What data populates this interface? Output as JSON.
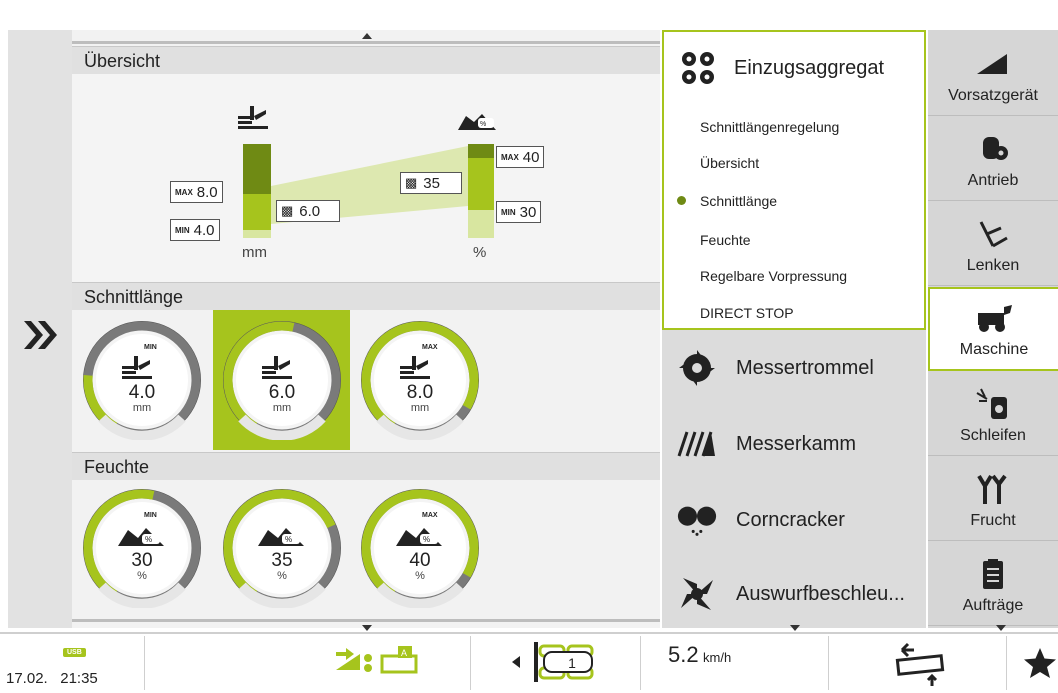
{
  "overview": {
    "title": "Übersicht",
    "left_bar": {
      "max": "8.0",
      "min": "4.0",
      "current": "6.0",
      "unit": "mm",
      "max_tag": "MAX",
      "min_tag": "MIN"
    },
    "right_bar": {
      "max": "40",
      "min": "30",
      "current": "35",
      "unit": "%",
      "max_tag": "MAX",
      "min_tag": "MIN"
    }
  },
  "schnittlaenge": {
    "title": "Schnittlänge",
    "gauges": [
      {
        "value": "4.0",
        "unit": "mm",
        "tag": "MIN",
        "fill": 0.18
      },
      {
        "value": "6.0",
        "unit": "mm",
        "tag": "",
        "fill": 0.45
      },
      {
        "value": "8.0",
        "unit": "mm",
        "tag": "MAX",
        "fill": 0.75
      }
    ]
  },
  "feuchte": {
    "title": "Feuchte",
    "gauges": [
      {
        "value": "30",
        "unit": "%",
        "tag": "MIN",
        "fill": 0.45
      },
      {
        "value": "35",
        "unit": "%",
        "tag": "",
        "fill": 0.6
      },
      {
        "value": "40",
        "unit": "%",
        "tag": "MAX",
        "fill": 0.75
      }
    ]
  },
  "menu": {
    "active": {
      "title": "Einzugsaggregat",
      "items": [
        "Schnittlängenregelung",
        "Übersicht",
        "Schnittlänge",
        "Feuchte",
        "Regelbare Vorpressung",
        "DIRECT STOP"
      ],
      "selected_index": 2
    },
    "items": [
      {
        "label": "Messertrommel",
        "icon": "knife-drum-icon"
      },
      {
        "label": "Messerkamm",
        "icon": "knife-comb-icon"
      },
      {
        "label": "Corncracker",
        "icon": "corncracker-icon"
      },
      {
        "label": "Auswurfbeschleu...",
        "icon": "accelerator-icon"
      }
    ]
  },
  "tabs": [
    {
      "label": "Vorsatzgerät",
      "icon": "header-icon"
    },
    {
      "label": "Antrieb",
      "icon": "drive-icon"
    },
    {
      "label": "Lenken",
      "icon": "steering-icon"
    },
    {
      "label": "Maschine",
      "icon": "machine-icon"
    },
    {
      "label": "Schleifen",
      "icon": "grinding-icon"
    },
    {
      "label": "Frucht",
      "icon": "crop-icon"
    },
    {
      "label": "Aufträge",
      "icon": "orders-icon"
    }
  ],
  "status": {
    "usb": "USB",
    "date": "17.02.",
    "time": "21:35",
    "gear": "1",
    "speed": "5.2",
    "speed_unit": "km/h"
  },
  "colors": {
    "accent": "#a6c41d",
    "dark_green": "#6f8a14"
  }
}
